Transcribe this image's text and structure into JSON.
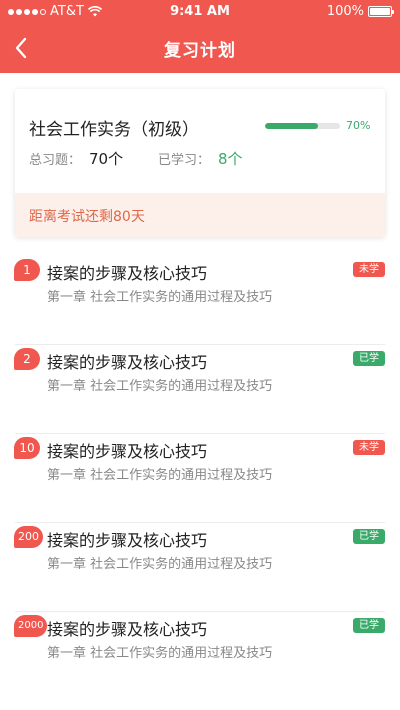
{
  "status_bar": {
    "carrier": "AT&T",
    "time": "9:41 AM",
    "battery": "100%"
  },
  "nav": {
    "title": "复习计划"
  },
  "course": {
    "title": "社会工作实务（初级）",
    "progress": 0.7,
    "progress_label": "70%",
    "total_label": "总习题：",
    "total_value": "70个",
    "learned_label": "已学习：",
    "learned_value": "8个",
    "countdown": "距离考试还剩80天"
  },
  "colors": {
    "brand": "#f0574e",
    "green": "#3aaa6a",
    "countdown_bg": "#fdf0ea",
    "countdown_text": "#e0674a"
  },
  "items": [
    {
      "number": "1",
      "title": "接案的步骤及核心技巧",
      "subtitle": "第一章 社会工作实务的通用过程及技巧",
      "status": "未学",
      "status_type": "unlearned"
    },
    {
      "number": "2",
      "title": "接案的步骤及核心技巧",
      "subtitle": "第一章 社会工作实务的通用过程及技巧",
      "status": "已学",
      "status_type": "learned"
    },
    {
      "number": "10",
      "title": "接案的步骤及核心技巧",
      "subtitle": "第一章 社会工作实务的通用过程及技巧",
      "status": "未学",
      "status_type": "unlearned"
    },
    {
      "number": "200",
      "title": "接案的步骤及核心技巧",
      "subtitle": "第一章 社会工作实务的通用过程及技巧",
      "status": "已学",
      "status_type": "learned"
    },
    {
      "number": "2000",
      "title": "接案的步骤及核心技巧",
      "subtitle": "第一章 社会工作实务的通用过程及技巧",
      "status": "已学",
      "status_type": "learned"
    }
  ]
}
